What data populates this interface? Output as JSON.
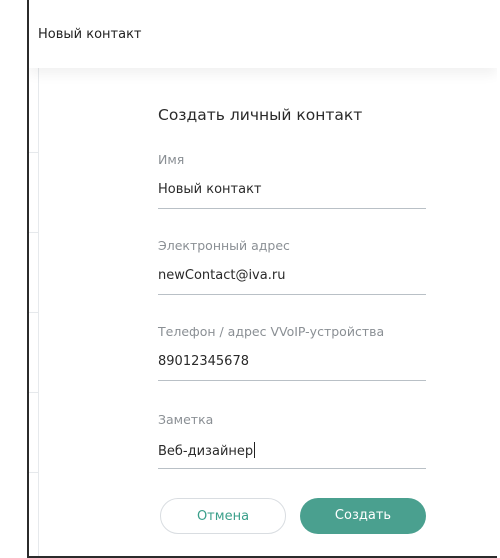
{
  "header": {
    "title": "Новый контакт"
  },
  "form": {
    "title": "Создать личный контакт",
    "fields": [
      {
        "label": "Имя",
        "value": "Новый контакт"
      },
      {
        "label": "Электронный адрес",
        "value": "newContact@iva.ru"
      },
      {
        "label": "Телефон / адрес VVoIP-устройства",
        "value": "89012345678"
      },
      {
        "label": "Заметка",
        "value": "Веб-дизайнер"
      }
    ],
    "cancel_label": "Отмена",
    "create_label": "Создать"
  },
  "colors": {
    "accent": "#4aa08f",
    "accent_text": "#3a9f8a",
    "label": "#8a8f94",
    "underline": "#b9c0c6"
  }
}
